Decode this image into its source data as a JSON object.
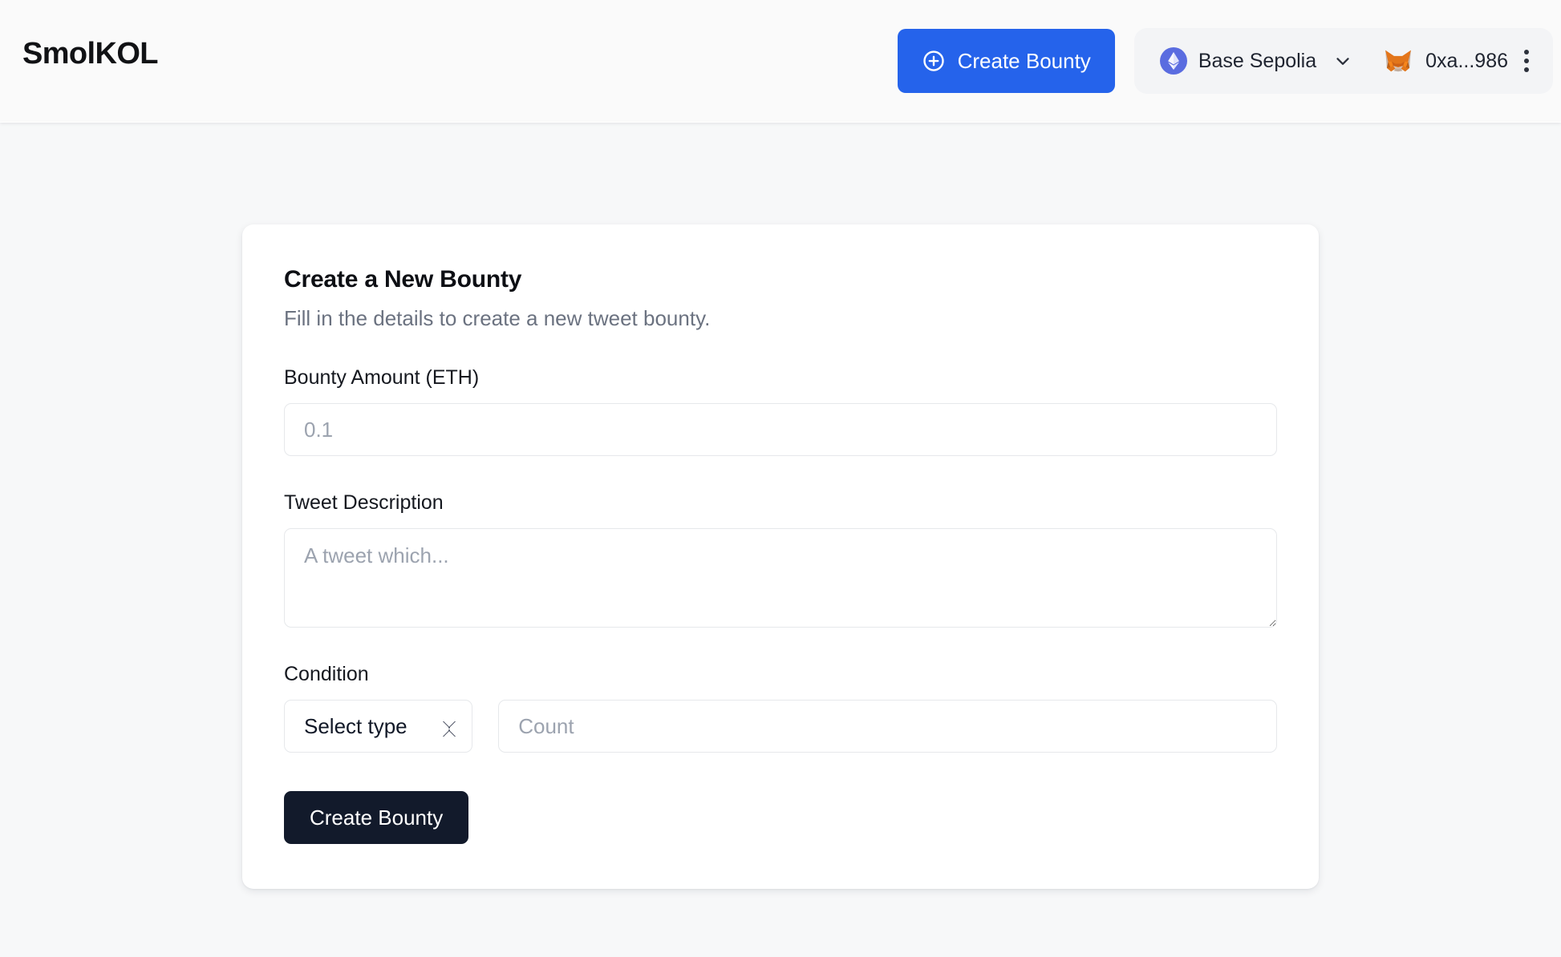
{
  "header": {
    "brand": "SmolKOL",
    "create_bounty_button": {
      "label": "Create Bounty",
      "icon": "plus-circle-icon",
      "color": "#2563eb"
    },
    "network": {
      "label": "Base Sepolia",
      "icon": "ethereum-icon",
      "icon_color": "#5a6ce0",
      "chevron": "chevron-down-icon"
    },
    "account": {
      "address": "0xa...986",
      "icon": "metamask-fox-icon"
    },
    "overflow_menu": "kebab-menu-icon"
  },
  "card": {
    "title": "Create a New Bounty",
    "subtitle": "Fill in the details to create a new tweet bounty.",
    "fields": {
      "amount": {
        "label": "Bounty Amount (ETH)",
        "placeholder": "0.1",
        "value": ""
      },
      "description": {
        "label": "Tweet Description",
        "placeholder": "A tweet which...",
        "value": ""
      },
      "condition": {
        "label": "Condition",
        "type_select": {
          "selected": "Select type",
          "options": [
            "Select type"
          ]
        },
        "count": {
          "placeholder": "Count",
          "value": ""
        }
      }
    },
    "submit_button": {
      "label": "Create Bounty",
      "color": "#121a2b"
    }
  },
  "theme": {
    "page_background": "#f7f8f9",
    "header_background": "#fafafa",
    "card_background": "#ffffff",
    "accent": "#2563eb",
    "muted_text": "#6b7280",
    "border": "#e6e8eb"
  }
}
